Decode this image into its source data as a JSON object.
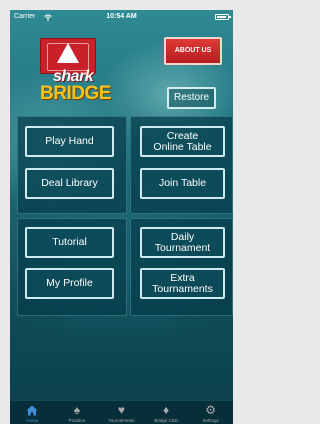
{
  "status_bar": {
    "carrier": "Carrier",
    "wifi_icon": "wifi-icon",
    "time": "10:54 AM",
    "battery_icon": "battery-icon"
  },
  "logo": {
    "line1": "shark",
    "line2": "BRIDGE"
  },
  "header": {
    "about_us_label": "ABOUT US",
    "restore_label": "Restore"
  },
  "play_panel": {
    "play_hand": "Play Hand",
    "create_online_table": "Create\nOnline Table",
    "deal_library": "Deal Library",
    "join_table": "Join Table"
  },
  "learn_panel": {
    "tutorial": "Tutorial",
    "daily_tournament": "Daily\nTournament",
    "my_profile": "My Profile",
    "extra_tournaments": "Extra\nTournaments"
  },
  "tab_bar": {
    "active_color": "#3f8fd6",
    "tabs": [
      {
        "label": "Home",
        "icon": "home-icon"
      },
      {
        "label": "Practice",
        "icon": "spade-icon"
      },
      {
        "label": "Tournaments",
        "icon": "heart-icon"
      },
      {
        "label": "Bridge Club",
        "icon": "diamond-icon"
      },
      {
        "label": "Settings",
        "icon": "gear-icon"
      }
    ]
  }
}
